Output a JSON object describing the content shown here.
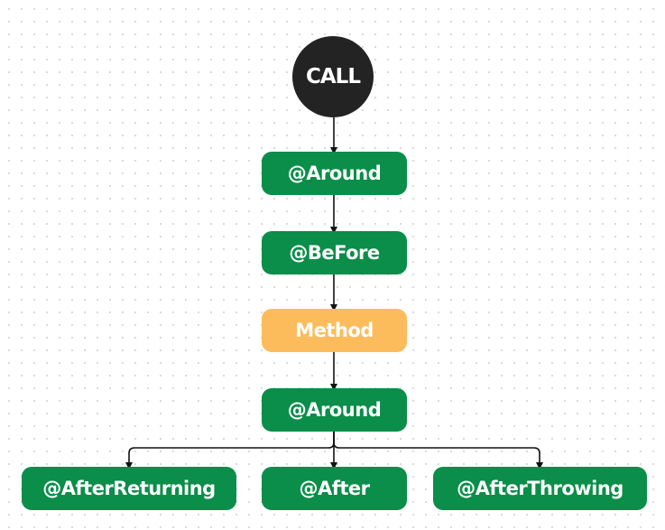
{
  "nodes": {
    "call": "CALL",
    "around_top": "@Around",
    "before": "@BeFore",
    "method": "Method",
    "around_bottom": "@Around",
    "after_returning": "@AfterReturning",
    "after": "@After",
    "after_throwing": "@AfterThrowing"
  },
  "colors": {
    "advice": "#0a8e49",
    "method": "#fdbc5b",
    "call": "#232323",
    "edge": "#111111"
  }
}
